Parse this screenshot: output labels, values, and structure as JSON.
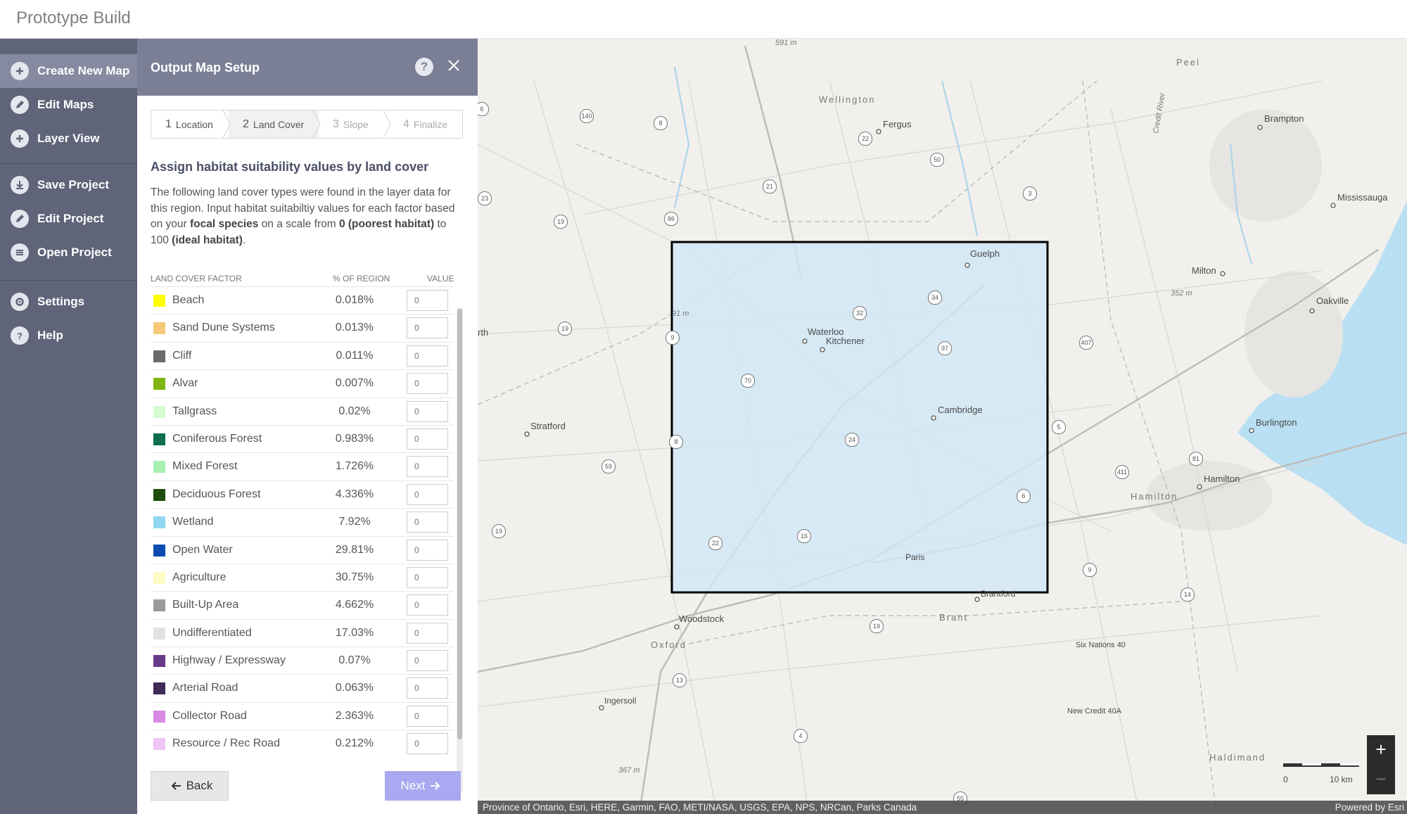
{
  "app": {
    "title": "Prototype Build"
  },
  "sidebar": {
    "items": [
      {
        "label": "Create New Map",
        "icon": "plus-circle-icon",
        "active": true
      },
      {
        "label": "Edit Maps",
        "icon": "pencil-icon"
      },
      {
        "label": "Layer View",
        "icon": "plus-circle-icon"
      },
      {
        "label": "Save Project",
        "icon": "download-icon"
      },
      {
        "label": "Edit Project",
        "icon": "pencil-icon"
      },
      {
        "label": "Open Project",
        "icon": "folder-icon"
      },
      {
        "label": "Settings",
        "icon": "gear-icon"
      },
      {
        "label": "Help",
        "icon": "question-icon"
      }
    ]
  },
  "panel": {
    "title": "Output Map Setup",
    "help_icon": "?",
    "steps": [
      {
        "num": "1",
        "label": "Location",
        "state": "done"
      },
      {
        "num": "2",
        "label": "Land Cover",
        "state": "active"
      },
      {
        "num": "3",
        "label": "Slope",
        "state": "future"
      },
      {
        "num": "4",
        "label": "Finalize",
        "state": "future"
      }
    ],
    "heading": "Assign habitat suitability values by land cover",
    "desc_part1": "The following land cover types were found in the layer data for this region. Input habitat suitabiltiy values for each factor based on your ",
    "desc_bold1": "focal species",
    "desc_part2": " on a scale from ",
    "desc_bold2": "0 (poorest habitat)",
    "desc_part3": " to 100 ",
    "desc_bold3": "(ideal habitat)",
    "desc_part4": ".",
    "table": {
      "col_factor": "LAND COVER FACTOR",
      "col_pct": "% OF REGION",
      "col_value": "VALUE",
      "value_placeholder": "0",
      "rows": [
        {
          "label": "Beach",
          "pct": "0.018%",
          "color": "#ffff00"
        },
        {
          "label": "Sand Dune Systems",
          "pct": "0.013%",
          "color": "#f5c87a"
        },
        {
          "label": "Cliff",
          "pct": "0.011%",
          "color": "#6b6b6b"
        },
        {
          "label": "Alvar",
          "pct": "0.007%",
          "color": "#7fb512"
        },
        {
          "label": "Tallgrass",
          "pct": "0.02%",
          "color": "#d4fcd0"
        },
        {
          "label": "Coniferous Forest",
          "pct": "0.983%",
          "color": "#0e6e4e"
        },
        {
          "label": "Mixed Forest",
          "pct": "1.726%",
          "color": "#a7f0b2"
        },
        {
          "label": "Deciduous Forest",
          "pct": "4.336%",
          "color": "#1f4d0d"
        },
        {
          "label": "Wetland",
          "pct": "7.92%",
          "color": "#8fd7f0"
        },
        {
          "label": "Open Water",
          "pct": "29.81%",
          "color": "#0b4bb0"
        },
        {
          "label": "Agriculture",
          "pct": "30.75%",
          "color": "#fdfcc5"
        },
        {
          "label": "Built-Up Area",
          "pct": "4.662%",
          "color": "#9a9a9a"
        },
        {
          "label": "Undifferentiated",
          "pct": "17.03%",
          "color": "#e2e2e2"
        },
        {
          "label": "Highway / Expressway",
          "pct": "0.07%",
          "color": "#6a3a8a"
        },
        {
          "label": "Arterial Road",
          "pct": "0.063%",
          "color": "#3f2b55"
        },
        {
          "label": "Collector Road",
          "pct": "2.363%",
          "color": "#d98be3"
        },
        {
          "label": "Resource / Rec Road",
          "pct": "0.212%",
          "color": "#efc6f5"
        }
      ]
    },
    "back_label": "Back",
    "next_label": "Next"
  },
  "map": {
    "places": {
      "peel": "Peel",
      "wellington": "Wellington",
      "fergus": "Fergus",
      "brampton": "Brampton",
      "mississauga": "Mississauga",
      "milton": "Milton",
      "oakville": "Oakville",
      "guelph": "Guelph",
      "waterloo": "Waterloo",
      "kitchener": "Kitchener",
      "cambridge": "Cambridge",
      "stratford": "Stratford",
      "burlington": "Burlington",
      "hamilton_region": "Hamilton",
      "hamilton": "Hamilton",
      "paris": "Paris",
      "brantford": "Brantford",
      "brant": "Brant",
      "woodstock": "Woodstock",
      "oxford": "Oxford",
      "ingersoll": "Ingersoll",
      "six_nations": "Six Nations 40",
      "new_credit": "New Credit 40A",
      "haldimand": "Haldimand",
      "perth": "rth",
      "credit_river": "Credit River"
    },
    "elevations": {
      "e591": "591 m",
      "e352": "352 m",
      "e367": "367 m",
      "e491": "91 m"
    },
    "highway_shields": [
      "140",
      "8",
      "22",
      "50",
      "3",
      "21",
      "86",
      "23",
      "19",
      "19",
      "34",
      "32",
      "407",
      "9",
      "97",
      "70",
      "5",
      "59",
      "8",
      "24",
      "411",
      "6",
      "81",
      "19",
      "16",
      "22",
      "9",
      "14",
      "19",
      "13",
      "4",
      "55",
      "6"
    ],
    "scale": {
      "zero": "0",
      "label": "10 km"
    },
    "zoom_in": "+",
    "zoom_out": "−",
    "attribution": "Province of Ontario, Esri, HERE, Garmin, FAO, METI/NASA, USGS, EPA, NPS, NRCan, Parks Canada",
    "powered_by": "Powered by Esri",
    "selection_fill": "#cfe6f6"
  }
}
